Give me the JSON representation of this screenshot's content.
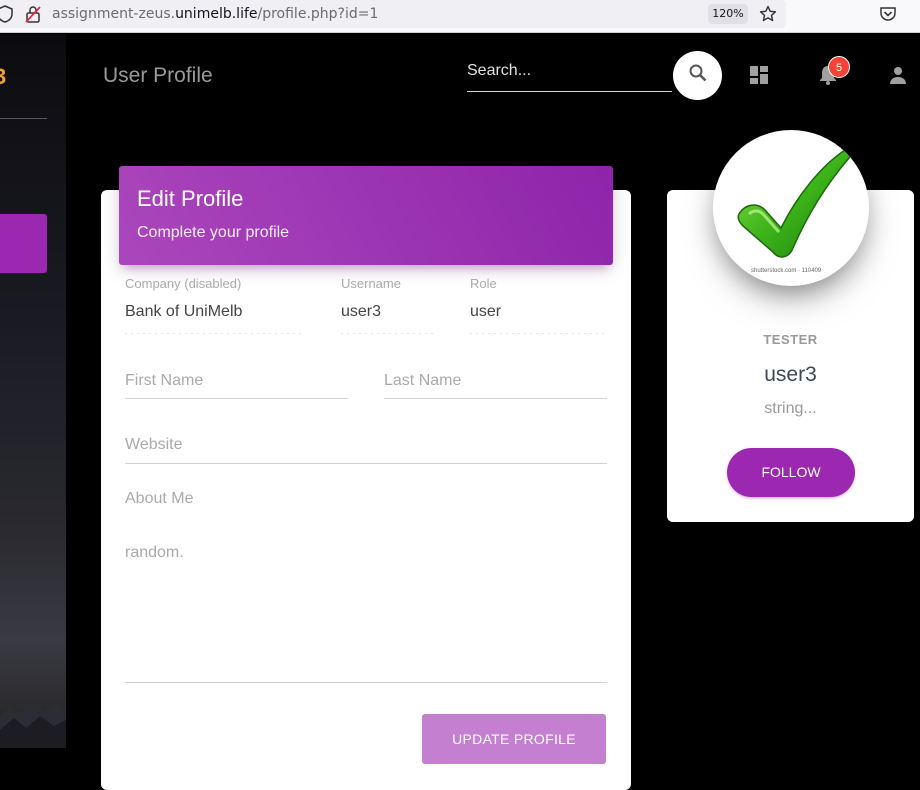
{
  "browser": {
    "url_prefix": "assignment-zeus.",
    "url_host": "unimelb.life",
    "url_path": "/profile.php?id=1",
    "zoom": "120%"
  },
  "sidebar": {
    "logo_fragment": "3"
  },
  "header": {
    "title": "User Profile",
    "search_placeholder": "Search...",
    "notification_count": "5"
  },
  "edit_profile": {
    "title": "Edit Profile",
    "subtitle": "Complete your profile",
    "company_label": "Company (disabled)",
    "company_value": "Bank of UniMelb",
    "username_label": "Username",
    "username_value": "user3",
    "role_label": "Role",
    "role_value": "user",
    "first_name_placeholder": "First Name",
    "last_name_placeholder": "Last Name",
    "website_placeholder": "Website",
    "about_label": "About Me",
    "about_value": "random.",
    "update_button": "UPDATE PROFILE"
  },
  "profile_card": {
    "avatar_caption": "shutterstock.com · 110409",
    "role": "TESTER",
    "name": "user3",
    "bio": "string...",
    "follow_button": "FOLLOW"
  },
  "colors": {
    "accent": "#9c27b0",
    "notification": "#f44336"
  }
}
